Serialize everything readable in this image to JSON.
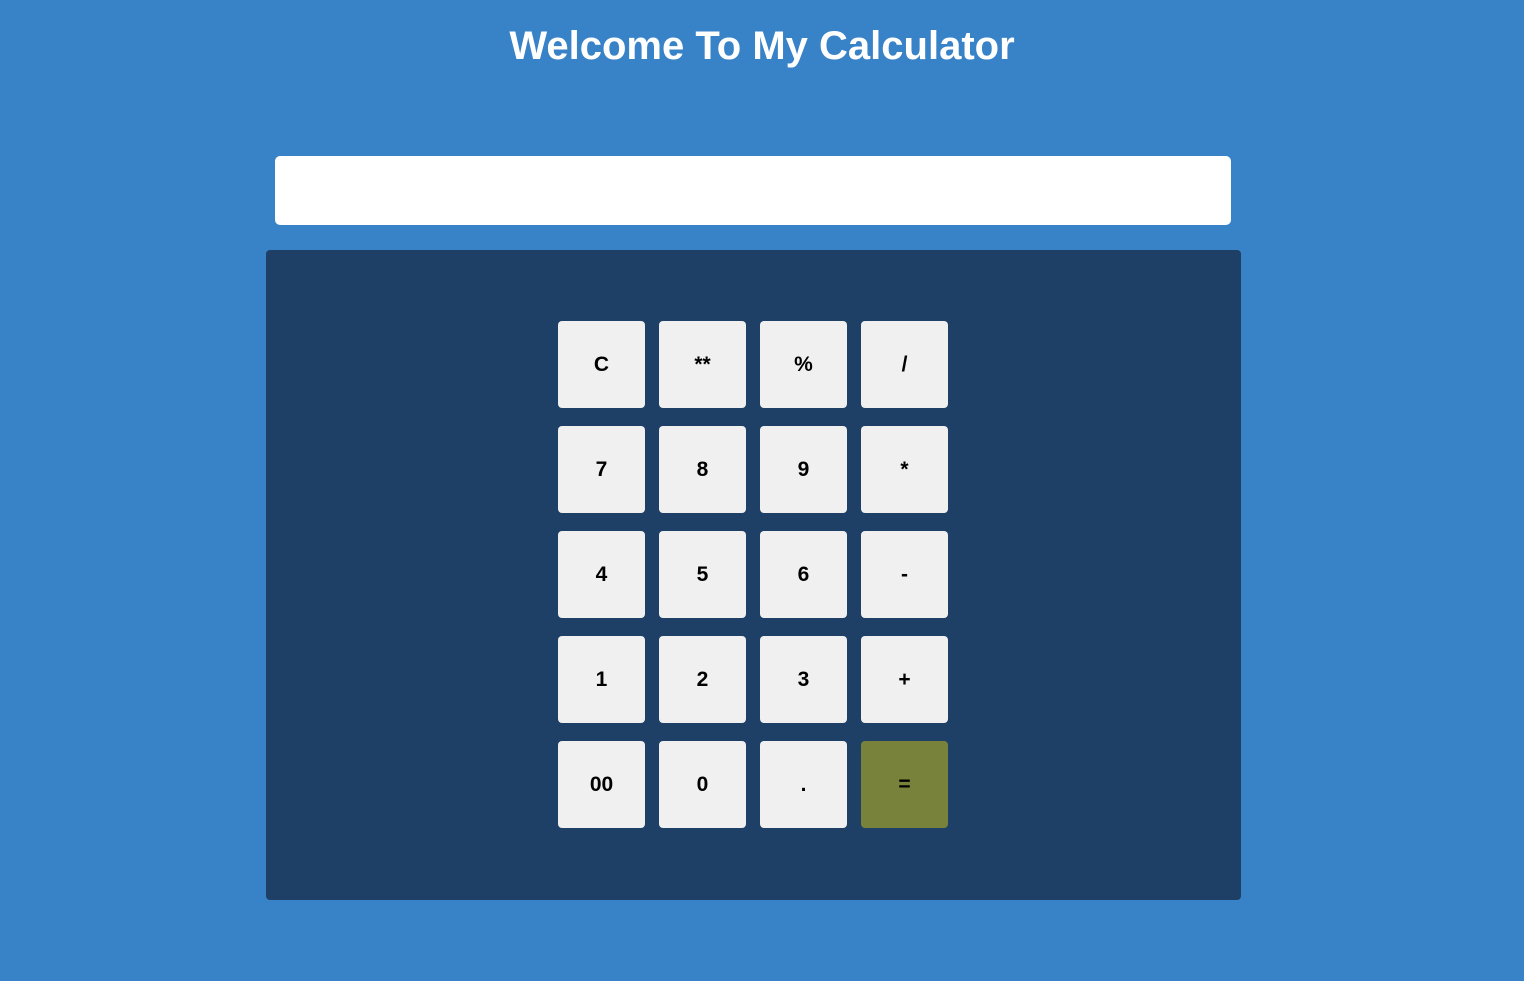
{
  "page": {
    "title": "Welcome To My Calculator"
  },
  "display": {
    "value": "",
    "placeholder": ""
  },
  "keys": {
    "clear": "C",
    "power": "**",
    "percent": "%",
    "divide": "/",
    "seven": "7",
    "eight": "8",
    "nine": "9",
    "multiply": "*",
    "four": "4",
    "five": "5",
    "six": "6",
    "subtract": "-",
    "one": "1",
    "two": "2",
    "three": "3",
    "add": "+",
    "double_zero": "00",
    "zero": "0",
    "decimal": ".",
    "equals": "="
  },
  "colors": {
    "page_background": "#3882c7",
    "panel_background": "#1e4066",
    "key_background": "#f0f0f0",
    "equals_background": "#79823b",
    "title_color": "#ffffff"
  }
}
